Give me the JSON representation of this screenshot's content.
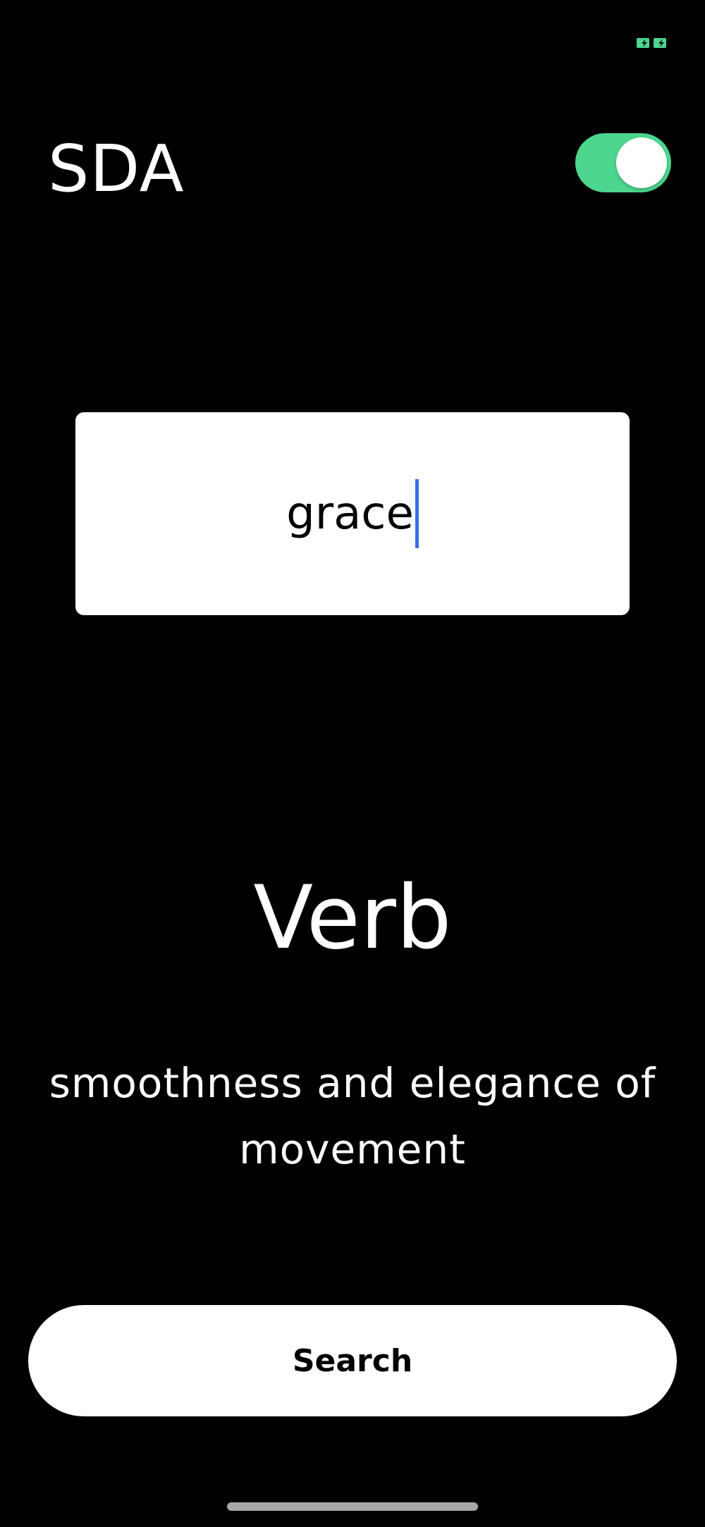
{
  "status_bar": {
    "indicator_icon": "battery-charging-icon",
    "indicator_color": "#4cd68e"
  },
  "header": {
    "title": "SDA",
    "toggle_state": "on",
    "toggle_color": "#4cd68e"
  },
  "search": {
    "input_value": "grace",
    "caret_color": "#3a6ee8"
  },
  "result": {
    "part_of_speech": "Verb",
    "definition": "smoothness and elegance of movement"
  },
  "actions": {
    "search_label": "Search"
  }
}
